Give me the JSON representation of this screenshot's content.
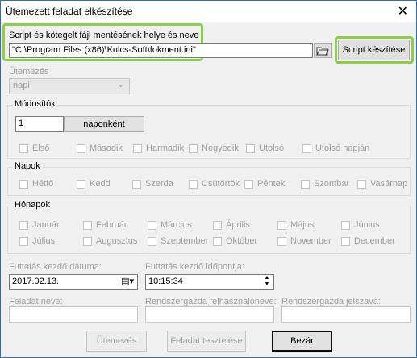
{
  "window": {
    "title": "Ütemezett feladat elkészítése",
    "close_glyph": "✕"
  },
  "script_path": {
    "label": "Script és kötegelt fájl mentésének helye és neve",
    "value": "\"C:\\Program Files (x86)\\Kulcs-Soft\\fokment.ini\"",
    "browse_icon": "folder-open-icon",
    "create_button": "Script készítése"
  },
  "schedule": {
    "label": "Ütemezés",
    "selected": "napi"
  },
  "modifiers": {
    "title": "Módosítók",
    "interval_value": "1",
    "interval_button": "naponként",
    "checks": [
      "Első",
      "Második",
      "Harmadik",
      "Negyedik",
      "Utolsó",
      "Utolsó napján"
    ]
  },
  "days": {
    "title": "Napok",
    "items": [
      "Hétfő",
      "Kedd",
      "Szerda",
      "Csütörtök",
      "Péntek",
      "Szombat",
      "Vasárnap"
    ]
  },
  "months": {
    "title": "Hónapok",
    "row1": [
      "Január",
      "Február",
      "Március",
      "Április",
      "Május",
      "Június"
    ],
    "row2": [
      "Július",
      "Augusztus",
      "Szeptember",
      "Október",
      "November",
      "December"
    ]
  },
  "start": {
    "date_label": "Futtatás kezdő dátuma:",
    "date_value": "2017.02.13.",
    "time_label": "Futtatás kezdő időpontja:",
    "time_value": "10:15:34"
  },
  "task": {
    "name_label": "Feladat neve:",
    "admin_user_label": "Rendszergazda felhasználóneve:",
    "admin_pass_label": "Rendszergazda jelszava:"
  },
  "buttons": {
    "schedule": "Ütemezés",
    "test": "Feladat tesztelése",
    "close": "Bezár"
  }
}
